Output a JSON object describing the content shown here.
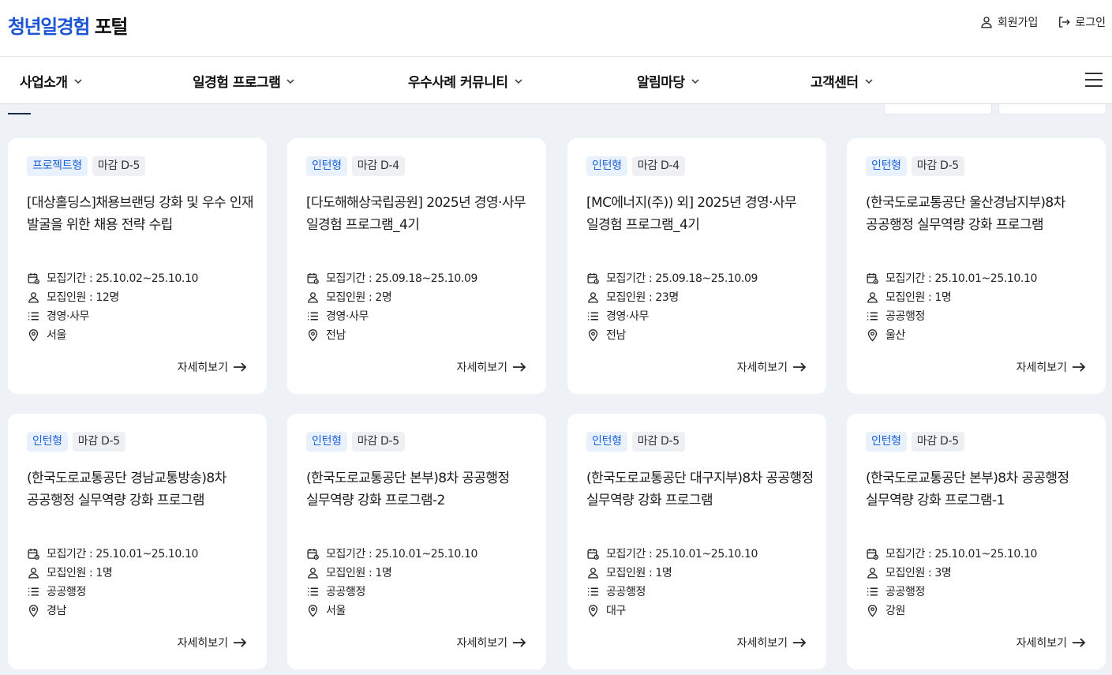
{
  "header": {
    "logo_accent": "청년일경험",
    "logo_rest": "포털",
    "signup_label": "회원가입",
    "login_label": "로그인"
  },
  "nav": {
    "items": [
      {
        "label": "사업소개"
      },
      {
        "label": "일경험 프로그램"
      },
      {
        "label": "우수사례 커뮤니티"
      },
      {
        "label": "알림마당"
      },
      {
        "label": "고객센터"
      }
    ]
  },
  "colors": {
    "brand": "#1b55d6",
    "tag_type_bg": "#e9f1fd",
    "tag_type_text": "#1c62d8",
    "tag_dday_bg": "#eef0f3",
    "page_bg": "#eef1f5"
  },
  "icons": {
    "period": "calendar-icon",
    "people": "person-icon",
    "category": "list-icon",
    "region": "location-pin-icon",
    "more": "arrow-right-icon"
  },
  "cards": [
    {
      "type": "프로젝트형",
      "dday": "마감 D-5",
      "title": "[대상홀딩스]채용브랜딩 강화 및 우수 인재 발굴을 위한 채용 전략 수립",
      "period": "모집기간 : 25.10.02~25.10.10",
      "people": "모집인원 : 12명",
      "category": "경영·사무",
      "region": "서울",
      "more": "자세히보기"
    },
    {
      "type": "인턴형",
      "dday": "마감 D-4",
      "title": "[다도해해상국립공원] 2025년 경영·사무 일경험 프로그램_4기",
      "period": "모집기간 : 25.09.18~25.10.09",
      "people": "모집인원 : 2명",
      "category": "경영·사무",
      "region": "전남",
      "more": "자세히보기"
    },
    {
      "type": "인턴형",
      "dday": "마감 D-4",
      "title": "[MC에너지(주)) 외] 2025년 경영·사무 일경험 프로그램_4기",
      "period": "모집기간 : 25.09.18~25.10.09",
      "people": "모집인원 : 23명",
      "category": "경영·사무",
      "region": "전남",
      "more": "자세히보기"
    },
    {
      "type": "인턴형",
      "dday": "마감 D-5",
      "title": "(한국도로교통공단 울산경남지부)8차 공공행정 실무역량 강화 프로그램",
      "period": "모집기간 : 25.10.01~25.10.10",
      "people": "모집인원 : 1명",
      "category": "공공행정",
      "region": "울산",
      "more": "자세히보기"
    },
    {
      "type": "인턴형",
      "dday": "마감 D-5",
      "title": "(한국도로교통공단 경남교통방송)8차 공공행정 실무역량 강화 프로그램",
      "period": "모집기간 : 25.10.01~25.10.10",
      "people": "모집인원 : 1명",
      "category": "공공행정",
      "region": "경남",
      "more": "자세히보기"
    },
    {
      "type": "인턴형",
      "dday": "마감 D-5",
      "title": "(한국도로교통공단 본부)8차 공공행정 실무역량 강화 프로그램-2",
      "period": "모집기간 : 25.10.01~25.10.10",
      "people": "모집인원 : 1명",
      "category": "공공행정",
      "region": "서울",
      "more": "자세히보기"
    },
    {
      "type": "인턴형",
      "dday": "마감 D-5",
      "title": "(한국도로교통공단 대구지부)8차 공공행정 실무역량 강화 프로그램",
      "period": "모집기간 : 25.10.01~25.10.10",
      "people": "모집인원 : 1명",
      "category": "공공행정",
      "region": "대구",
      "more": "자세히보기"
    },
    {
      "type": "인턴형",
      "dday": "마감 D-5",
      "title": "(한국도로교통공단 본부)8차 공공행정 실무역량 강화 프로그램-1",
      "period": "모집기간 : 25.10.01~25.10.10",
      "people": "모집인원 : 3명",
      "category": "공공행정",
      "region": "강원",
      "more": "자세히보기"
    }
  ]
}
